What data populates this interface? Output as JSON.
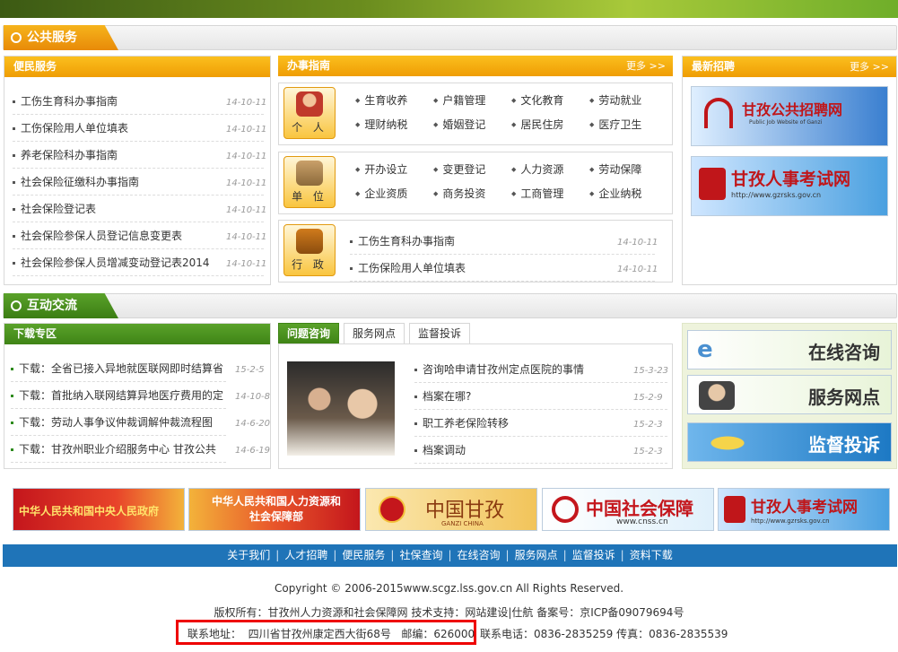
{
  "sections": {
    "public_service": "公共服务",
    "interaction": "互动交流"
  },
  "bianmin": {
    "title": "便民服务",
    "items": [
      {
        "text": "工伤生育科办事指南",
        "date": "14-10-11"
      },
      {
        "text": "工伤保险用人单位填表",
        "date": "14-10-11"
      },
      {
        "text": "养老保险科办事指南",
        "date": "14-10-11"
      },
      {
        "text": "社会保险征缴科办事指南",
        "date": "14-10-11"
      },
      {
        "text": "社会保险登记表",
        "date": "14-10-11"
      },
      {
        "text": "社会保险参保人员登记信息变更表",
        "date": "14-10-11"
      },
      {
        "text": "社会保险参保人员增减变动登记表2014",
        "date": "14-10-11"
      }
    ]
  },
  "guide": {
    "title": "办事指南",
    "more": "更多 >>",
    "personal": {
      "label": "个 人",
      "items": [
        "生育收养",
        "户籍管理",
        "文化教育",
        "劳动就业",
        "理财纳税",
        "婚姻登记",
        "居民住房",
        "医疗卫生"
      ]
    },
    "unit": {
      "label": "单 位",
      "items": [
        "开办设立",
        "变更登记",
        "人力资源",
        "劳动保障",
        "企业资质",
        "商务投资",
        "工商管理",
        "企业纳税"
      ]
    },
    "admin": {
      "label": "行 政",
      "items": [
        {
          "text": "工伤生育科办事指南",
          "date": "14-10-11"
        },
        {
          "text": "工伤保险用人单位填表",
          "date": "14-10-11"
        }
      ]
    }
  },
  "recruit": {
    "title": "最新招聘",
    "more": "更多 >>",
    "banner1": {
      "title": "甘孜公共招聘网",
      "sub": "Public Job Website of Ganzi"
    },
    "banner2": {
      "title": "甘孜人事考试网",
      "sub": "http://www.gzrsks.gov.cn"
    }
  },
  "download": {
    "title": "下载专区",
    "items": [
      {
        "text": "下载：全省已接入异地就医联网即时结算省",
        "date": "15-2-5"
      },
      {
        "text": "下载：首批纳入联网结算异地医疗费用的定",
        "date": "14-10-8"
      },
      {
        "text": "下载：劳动人事争议仲裁调解仲裁流程图",
        "date": "14-6-20"
      },
      {
        "text": "下载：甘孜州职业介绍服务中心 甘孜公共",
        "date": "14-6-19"
      }
    ]
  },
  "consult": {
    "tabs": [
      "问题咨询",
      "服务网点",
      "监督投诉"
    ],
    "items": [
      {
        "text": "咨询哈申请甘孜州定点医院的事情",
        "date": "15-3-23"
      },
      {
        "text": "档案在哪?",
        "date": "15-2-9"
      },
      {
        "text": "职工养老保险转移",
        "date": "15-2-3"
      },
      {
        "text": "档案调动",
        "date": "15-2-3"
      }
    ]
  },
  "quick": {
    "online": "在线咨询",
    "network": "服务网点",
    "complaint": "监督投诉"
  },
  "links": [
    {
      "text": "中华人民共和国中央人民政府"
    },
    {
      "text": "中华人民共和国人力资源和社会保障部"
    },
    {
      "text": "中国甘孜",
      "sub": "GANZI CHINA"
    },
    {
      "text": "中国社会保障",
      "sub": "www.cnss.cn"
    },
    {
      "text": "甘孜人事考试网",
      "sub": "http://www.gzrsks.gov.cn"
    }
  ],
  "footer": {
    "nav": [
      "关于我们",
      "人才招聘",
      "便民服务",
      "社保查询",
      "在线咨询",
      "服务网点",
      "监督投诉",
      "资料下载"
    ],
    "copyright": "Copyright © 2006-2015www.scgz.lss.gov.cn All Rights Reserved.",
    "owner": "版权所有：甘孜州人力资源和社会保障网   技术支持：网站建设|仕航   备案号：京ICP备09079694号",
    "address": "联系地址：  四川省甘孜州康定西大街68号   邮编：626000",
    "phone": "联系电话：0836-2835259 传真：0836-2835539"
  },
  "colors": {
    "orange": "#f0a00a",
    "green": "#3f8416",
    "blue": "#1f74b8",
    "red_highlight": "#e00000"
  }
}
